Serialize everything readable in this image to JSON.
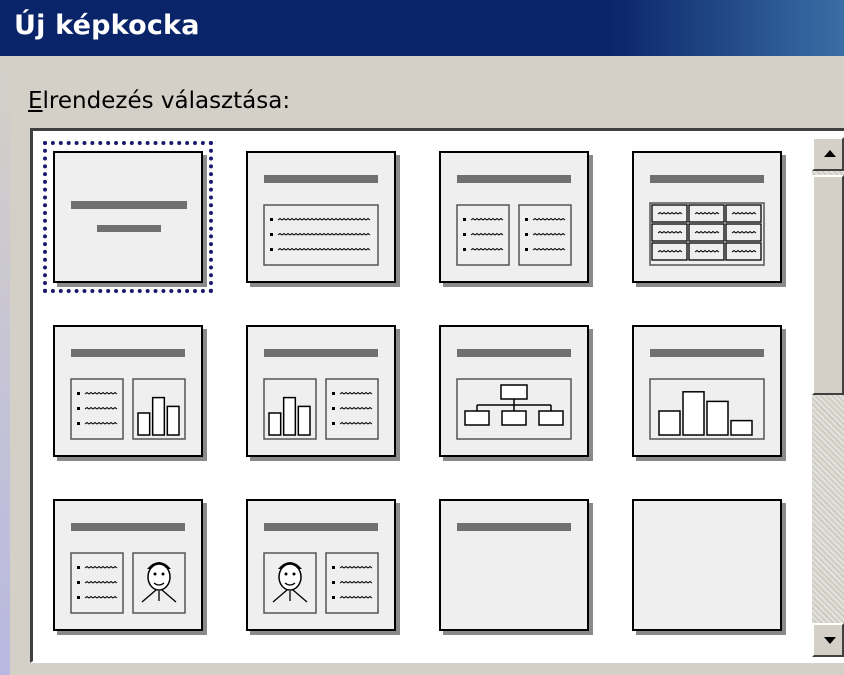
{
  "window": {
    "title": "Új képkocka"
  },
  "layout_label": {
    "first": "E",
    "rest": "lrendezés választása:"
  },
  "layouts": [
    {
      "type": "title"
    },
    {
      "type": "bulleted-list"
    },
    {
      "type": "two-column-text"
    },
    {
      "type": "table"
    },
    {
      "type": "text-and-chart"
    },
    {
      "type": "chart-and-text"
    },
    {
      "type": "organization-chart"
    },
    {
      "type": "chart"
    },
    {
      "type": "text-and-clip-art"
    },
    {
      "type": "clip-art-and-text"
    },
    {
      "type": "title-only"
    },
    {
      "type": "blank"
    }
  ],
  "selected_index": 0,
  "colors": {
    "titlebar": "#0a246a",
    "selection": "#1a1a6e",
    "bar": "#707070"
  }
}
